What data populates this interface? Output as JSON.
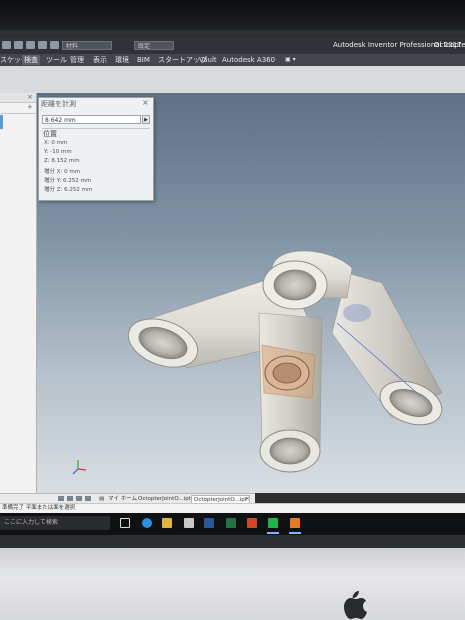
{
  "quick_access": {
    "selector_material": "材料",
    "selector_appearance": "既定",
    "app_title": "Autodesk Inventor Professional 2017",
    "file_title": "Octcopter"
  },
  "ribbon_tabs": [
    {
      "label": "スケッチ"
    },
    {
      "label": "検査"
    },
    {
      "label": "ツール"
    },
    {
      "label": "管理"
    },
    {
      "label": "表示"
    },
    {
      "label": "環境"
    },
    {
      "label": "BIM"
    },
    {
      "label": "スタートアップ"
    },
    {
      "label": "Vault"
    },
    {
      "label": "Autodesk A360"
    }
  ],
  "browser": {
    "close_glyph": "×",
    "expand_glyph": "+"
  },
  "measure": {
    "title": "距離を計測",
    "close_glyph": "×",
    "value": "8.642 mm",
    "arrow_glyph": "▶",
    "section_title": "位置",
    "rows": [
      {
        "text": "X: 0 mm"
      },
      {
        "text": "Y: -10 mm"
      },
      {
        "text": "Z: 8.152 mm"
      },
      {
        "text": "増分 X: 0 mm"
      },
      {
        "text": "増分 Y: 6.252 mm"
      },
      {
        "text": "増分 Z: 6.252 mm"
      }
    ]
  },
  "doc_tabs": {
    "home": "マイ ホーム",
    "tab1": "OctopterJointO...ipt",
    "tab2": "OctopterJointO...ipt",
    "close_glyph": "×"
  },
  "status": {
    "text": "準備完了 平面または面を選択"
  },
  "taskbar": {
    "search_placeholder": "ここに入力して検索"
  },
  "colors": {
    "tube": "#e7e5df",
    "highlight": "#d9a67a",
    "viewport_top": "#5e7285",
    "viewport_bottom": "#d9dee3"
  }
}
